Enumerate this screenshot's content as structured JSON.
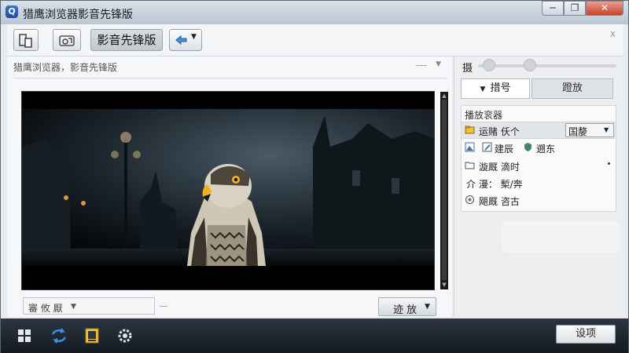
{
  "window": {
    "title": "猎鹰浏览器影音先锋版",
    "close_glyph": "✕",
    "min_glyph": "─",
    "max_glyph": "❐"
  },
  "toolbar": {
    "button_main_label": "影音先锋版",
    "panel_close_glyph": "x",
    "icons": [
      "devices-icon",
      "link-icon",
      "arrow-back-icon"
    ]
  },
  "left_panel": {
    "header": "猎鹰浏览器，影音先锋版",
    "bottom_combo_value": "審 攸 厭",
    "play_button_label": "迹 放"
  },
  "right_panel": {
    "slider_label": "摄",
    "tab1_label": "措号",
    "tab2_label": "蹬放",
    "list_title": "播放衮器",
    "rows": [
      {
        "icon": "folder-yellow-icon",
        "text": "运赌  仸个",
        "select_value": "国嫠"
      },
      {
        "icon": "image-icon",
        "items": [
          "建辰",
          "遡东"
        ]
      },
      {
        "icon": "folder-icon",
        "text": "漩厩  滴时"
      },
      {
        "icon": "info-icon",
        "text": "介 漫：  槧/奔"
      },
      {
        "icon": "circle-icon",
        "text": "飓厩  咨古"
      }
    ],
    "row2_extra_icons": [
      "edit-icon",
      "shield-icon"
    ]
  },
  "taskbar": {
    "settings_label": "设项",
    "icons": [
      "grid-icon",
      "sync-icon",
      "note-icon",
      "gear-icon"
    ]
  },
  "colors": {
    "video_bg": "#000000",
    "taskbar_bg": "#1c232b",
    "accent_blue": "#2f6fd1"
  }
}
